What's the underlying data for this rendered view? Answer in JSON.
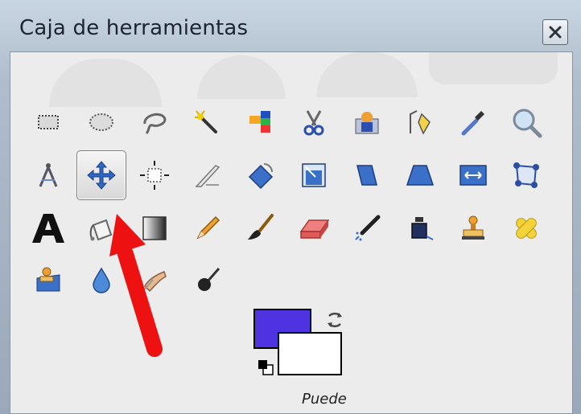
{
  "window": {
    "title": "Caja de herramientas",
    "close_icon": "close-icon"
  },
  "toolbox": {
    "selected_tool": "move-tool",
    "rows": [
      [
        "rect-select-tool",
        "ellipse-select-tool",
        "free-select-tool",
        "fuzzy-select-tool",
        "select-by-color-tool",
        "scissors-select-tool",
        "foreground-select-tool",
        "paths-tool",
        "color-picker-tool",
        "zoom-tool"
      ],
      [
        "measure-tool",
        "move-tool",
        "align-tool",
        "crop-tool",
        "rotate-tool",
        "scale-tool",
        "shear-tool",
        "perspective-tool",
        "flip-tool",
        "cage-transform-tool"
      ],
      [
        "text-tool",
        "bucket-fill-tool",
        "blend-tool",
        "pencil-tool",
        "paintbrush-tool",
        "eraser-tool",
        "airbrush-tool",
        "ink-tool",
        "clone-tool",
        "heal-tool"
      ],
      [
        "perspective-clone-tool",
        "blur-sharpen-tool",
        "smudge-tool",
        "dodge-burn-tool"
      ]
    ]
  },
  "colors": {
    "foreground": "#4f32e0",
    "background": "#ffffff"
  },
  "hint_text": "Puede",
  "annotation": {
    "arrow_color": "#ee1111",
    "points_to": "bucket-fill-tool"
  }
}
